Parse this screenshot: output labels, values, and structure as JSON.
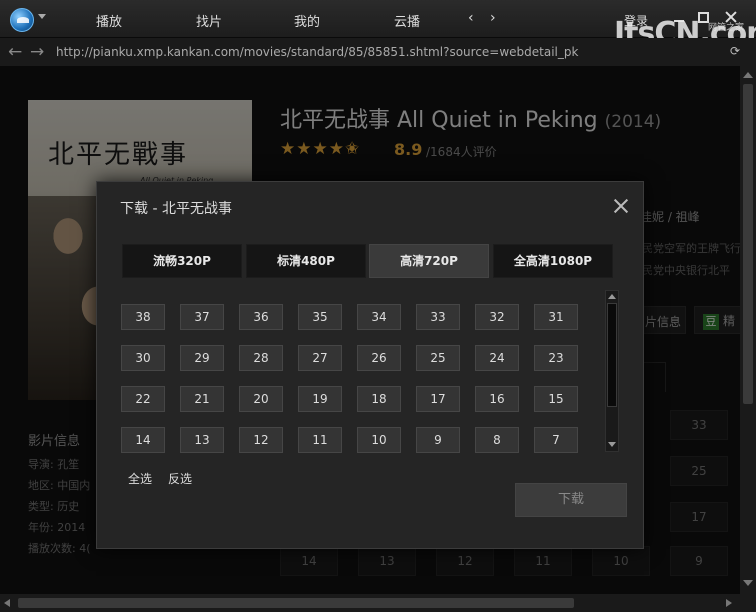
{
  "titlebar": {
    "nav": [
      "播放",
      "找片",
      "我的",
      "云播"
    ],
    "history_arrows": "‹ ›",
    "login": "登录",
    "watermark": "ItsCN.com",
    "watermark_sub": "网管之家"
  },
  "address": {
    "url": "http://pianku.xmp.kankan.com/movies/standard/85/85851.shtml?source=webdetail_pk"
  },
  "movie": {
    "poster_title": "北平无戰事",
    "poster_subtitle": "All Quiet in Peking",
    "title": "北平无战事 All Quiet in Peking",
    "year": "(2014)",
    "stars": "★★★★✬",
    "score": "8.9",
    "reviews": "/1684人评价",
    "cast_fragment": "佳妮 / 祖峰",
    "desc_line1": "民党空军的王牌飞行",
    "desc_line2": "民党中央银行北平",
    "info_button": "片信息",
    "douban_button": "精",
    "douban_icon": "豆"
  },
  "sidebar": {
    "section_title": "影片信息",
    "rows": [
      "导演: 孔笙",
      "地区: 中国内",
      "类型: 历史",
      "年份: 2014",
      "播放次数: 4("
    ]
  },
  "background_episodes": [
    "33",
    "25",
    "17",
    "14",
    "13",
    "12",
    "11",
    "10",
    "9"
  ],
  "dialog": {
    "title": "下载 - 北平无战事",
    "quality_tabs": [
      "流畅320P",
      "标清480P",
      "高清720P",
      "全高清1080P"
    ],
    "active_tab": 2,
    "episodes": [
      "38",
      "37",
      "36",
      "35",
      "34",
      "33",
      "32",
      "31",
      "30",
      "29",
      "28",
      "27",
      "26",
      "25",
      "24",
      "23",
      "22",
      "21",
      "20",
      "19",
      "18",
      "17",
      "16",
      "15",
      "14",
      "13",
      "12",
      "11",
      "10",
      "9",
      "8",
      "7"
    ],
    "select_all": "全选",
    "invert_select": "反选",
    "download_button": "下载"
  },
  "colors": {
    "accent_star": "#e0a43a",
    "background": "#141414",
    "dialog_bg": "#252525"
  }
}
